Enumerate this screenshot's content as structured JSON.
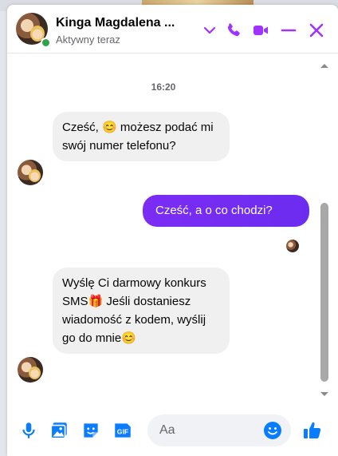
{
  "header": {
    "contact_name": "Kinga Magdalena ...",
    "status": "Aktywny teraz",
    "icons": [
      "chevron-down-icon",
      "phone-icon",
      "video-camera-icon",
      "minimize-icon",
      "close-icon"
    ],
    "accent_color": "#a033ff"
  },
  "conversation": {
    "timestamp": "16:20",
    "messages": [
      {
        "direction": "incoming",
        "text": "Cześć, 😊 możesz podać mi swój numer telefonu?"
      },
      {
        "direction": "outgoing",
        "text": "Cześć, a o co chodzi?"
      },
      {
        "direction": "incoming",
        "text": "Wyślę Ci darmowy konkurs SMS🎁 Jeśli dostaniesz wiadomość z kodem, wyślij go do mnie😊"
      }
    ],
    "bubble_colors": {
      "incoming": "#f0f0f0",
      "outgoing": "#7a2ff2"
    }
  },
  "composer": {
    "placeholder": "Aa",
    "icons": [
      "microphone-icon",
      "image-icon",
      "sticker-icon",
      "gif-icon",
      "emoji-icon",
      "thumbs-up-icon"
    ],
    "icon_color": "#0a7cff",
    "gif_label": "GIF"
  }
}
